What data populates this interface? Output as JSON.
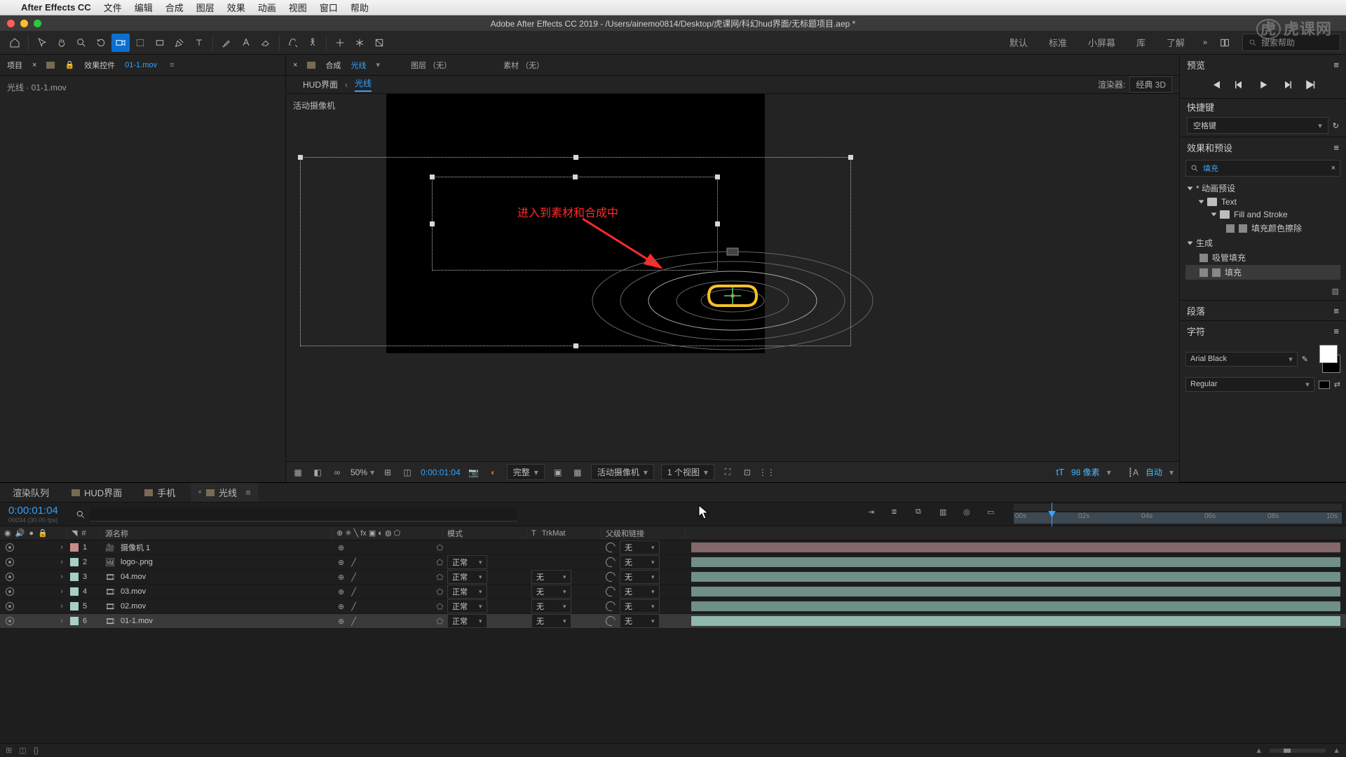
{
  "mac_menu": {
    "app": "After Effects CC",
    "items": [
      "文件",
      "编辑",
      "合成",
      "图层",
      "效果",
      "动画",
      "视图",
      "窗口",
      "帮助"
    ]
  },
  "window_title": "Adobe After Effects CC 2019 - /Users/ainemo0814/Desktop/虎课网/科幻hud界面/无标题项目.aep *",
  "workspaces": {
    "items": [
      "默认",
      "标准",
      "小屏幕",
      "库",
      "了解"
    ],
    "search_placeholder": "搜索帮助"
  },
  "project_panel": {
    "tab_project": "项目",
    "tab_fx": "效果控件",
    "fx_target": "01-1.mov",
    "breadcrumb": "光线 · 01-1.mov"
  },
  "comp_panel": {
    "tab_comp": "合成",
    "comp_name": "光线",
    "tab_layer": "图层 （无）",
    "tab_footage": "素材 （无）",
    "bc_parent": "HUD界面",
    "bc_active": "光线",
    "renderer_label": "渲染器:",
    "renderer_value": "经典 3D",
    "active_cam": "活动摄像机",
    "annotation": "进入到素材和合成中"
  },
  "viewer_footer": {
    "zoom": "50%",
    "timecode": "0:00:01:04",
    "res": "完整",
    "cam": "活动摄像机",
    "views": "1 个视图",
    "px_label": "98 像素",
    "auto": "自动"
  },
  "preview": {
    "title": "预览"
  },
  "shortcuts": {
    "title": "快捷键",
    "value": "空格键"
  },
  "effects_presets": {
    "title": "效果和预设",
    "search": "填充",
    "tree": {
      "anim": "* 动画预设",
      "text": "Text",
      "fillstroke": "Fill and Stroke",
      "preset1": "填充颜色擦除",
      "gen": "生成",
      "eyedrop": "吸管填充",
      "fill": "填充"
    }
  },
  "paragraph": {
    "title": "段落"
  },
  "character": {
    "title": "字符",
    "font": "Arial Black",
    "style": "Regular"
  },
  "timeline": {
    "tabs": [
      "渲染队列",
      "HUD界面",
      "手机",
      "光线"
    ],
    "active_tab": 3,
    "timecode": "0:00:01:04",
    "sub": "00034 (30.00 fps)",
    "cols": {
      "src": "源名称",
      "mode": "模式",
      "trk": "TrkMat",
      "parent": "父级和链接"
    },
    "ruler": [
      "00s",
      "02s",
      "04s",
      "06s",
      "08s",
      "10s"
    ],
    "layers": [
      {
        "n": 1,
        "name": "摄像机 1",
        "icon": "camera",
        "color": "#c98a8a",
        "mode": "",
        "trk": "",
        "par": "无",
        "bar": "#826868",
        "sel": false,
        "solo": false
      },
      {
        "n": 2,
        "name": "logo-.png",
        "icon": "image",
        "color": "#a7cfc7",
        "mode": "正常",
        "trk": "",
        "par": "无",
        "bar": "#6f8f88",
        "sel": false,
        "solo": true
      },
      {
        "n": 3,
        "name": "04.mov",
        "icon": "mov",
        "color": "#a7cfc7",
        "mode": "正常",
        "trk": "无",
        "par": "无",
        "bar": "#6f8f88",
        "sel": false,
        "solo": true
      },
      {
        "n": 4,
        "name": "03.mov",
        "icon": "mov",
        "color": "#a7cfc7",
        "mode": "正常",
        "trk": "无",
        "par": "无",
        "bar": "#6f8f88",
        "sel": false,
        "solo": true
      },
      {
        "n": 5,
        "name": "02.mov",
        "icon": "mov",
        "color": "#a7cfc7",
        "mode": "正常",
        "trk": "无",
        "par": "无",
        "bar": "#6f8f88",
        "sel": false,
        "solo": true
      },
      {
        "n": 6,
        "name": "01-1.mov",
        "icon": "mov",
        "color": "#a7cfc7",
        "mode": "正常",
        "trk": "无",
        "par": "无",
        "bar": "#8fb7af",
        "sel": true,
        "solo": true
      }
    ]
  },
  "watermark": "虎课网"
}
